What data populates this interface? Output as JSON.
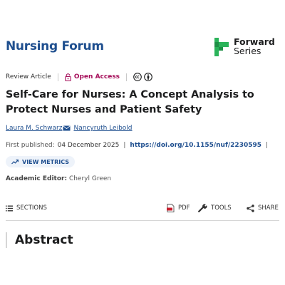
{
  "journal": {
    "title": "Nursing Forum"
  },
  "publisher": {
    "line1": "Forward",
    "line2": "Series",
    "brand_color": "#2bb35a"
  },
  "meta": {
    "article_type": "Review Article",
    "open_access": "Open Access",
    "oa_color": "#a6105b"
  },
  "article": {
    "title": "Self-Care for Nurses: A Concept Analysis to Protect Nurses and Patient Safety",
    "authors": [
      "Laura M. Schwarz",
      "Nancyruth Leibold"
    ],
    "first_published_label": "First published:",
    "first_published_date": "04 December 2025",
    "doi": "https://doi.org/10.1155/nuf/2230595",
    "metrics_label": "VIEW METRICS",
    "editor_label": "Academic Editor:",
    "editor_name": "Cheryl Green"
  },
  "toolbar": {
    "sections": "SECTIONS",
    "pdf": "PDF",
    "tools": "TOOLS",
    "share": "SHARE"
  },
  "abstract": {
    "heading": "Abstract"
  }
}
